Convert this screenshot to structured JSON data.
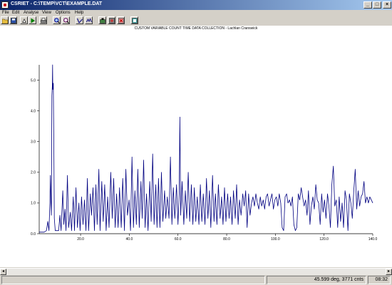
{
  "window": {
    "title": "CSRIET - C:\\TEMP\\VCT\\EXAMPLE.DAT"
  },
  "menu": [
    "File",
    "Edit",
    "Analyse",
    "View",
    "Options",
    "Help"
  ],
  "toolbar": {
    "icons": [
      "open-icon",
      "save-icon",
      "run-icon",
      "play-icon",
      "print-icon",
      "zoom-in-icon",
      "zoom-out-icon",
      "cursor-icon",
      "scale-icon",
      "export-icon",
      "color-icon",
      "delete-icon",
      "settings-icon"
    ]
  },
  "status": {
    "position": "45.599 deg, 3771 cnts",
    "time": "08:32"
  },
  "chart_data": {
    "type": "line",
    "title": "CUSTOM VARIABLE COUNT TIME DATA COLLECTION - Lachlan Cranswick",
    "xlabel": "",
    "ylabel": "",
    "xlim": [
      3,
      140
    ],
    "ylim": [
      0,
      5.5
    ],
    "x_ticks": [
      "20.0",
      "40.0",
      "60.0",
      "80.0",
      "100.0",
      "120.0",
      "140.0"
    ],
    "y_ticks": [
      "0.0",
      "1.0",
      "2.0",
      "3.0",
      "4.0",
      "5.0"
    ],
    "series": [
      {
        "points": [
          [
            3,
            0.05
          ],
          [
            5,
            0.05
          ],
          [
            6,
            0.1
          ],
          [
            6.5,
            0.4
          ],
          [
            7,
            0.1
          ],
          [
            7.4,
            1.0
          ],
          [
            7.6,
            1.9
          ],
          [
            7.8,
            1.0
          ],
          [
            8,
            0.6
          ],
          [
            8.2,
            4.5
          ],
          [
            8.4,
            4.8
          ],
          [
            8.5,
            5.5
          ],
          [
            8.6,
            4.7
          ],
          [
            8.8,
            4.9
          ],
          [
            9,
            3.0
          ],
          [
            9.2,
            0.5
          ],
          [
            9.6,
            0.1
          ],
          [
            11,
            0.1
          ],
          [
            11.5,
            0.6
          ],
          [
            12,
            0.1
          ],
          [
            12.7,
            1.4
          ],
          [
            13.1,
            0.3
          ],
          [
            13.6,
            0.8
          ],
          [
            14,
            0.1
          ],
          [
            14.6,
            1.9
          ],
          [
            15.1,
            0.2
          ],
          [
            15.8,
            0.7
          ],
          [
            16.3,
            0.1
          ],
          [
            17,
            1.2
          ],
          [
            17.5,
            0.1
          ],
          [
            18.1,
            1.5
          ],
          [
            18.7,
            0.2
          ],
          [
            19.3,
            1.0
          ],
          [
            19.8,
            0.1
          ],
          [
            20.4,
            1.2
          ],
          [
            21,
            0.3
          ],
          [
            21.6,
            1.1
          ],
          [
            22.2,
            0.1
          ],
          [
            22.8,
            1.8
          ],
          [
            23.3,
            0.1
          ],
          [
            24,
            1.3
          ],
          [
            24.5,
            0.6
          ],
          [
            25.1,
            1.5
          ],
          [
            25.7,
            0.1
          ],
          [
            26.3,
            1.6
          ],
          [
            26.8,
            0.3
          ],
          [
            27.5,
            2.1
          ],
          [
            28,
            0.1
          ],
          [
            28.7,
            1.7
          ],
          [
            29.3,
            0.4
          ],
          [
            29.9,
            1.6
          ],
          [
            30.5,
            0.1
          ],
          [
            31.1,
            1.2
          ],
          [
            31.7,
            0.2
          ],
          [
            32.4,
            2.0
          ],
          [
            33,
            0.5
          ],
          [
            33.6,
            1.8
          ],
          [
            34.2,
            0.2
          ],
          [
            34.8,
            1.3
          ],
          [
            35.4,
            0.2
          ],
          [
            36,
            1.5
          ],
          [
            36.7,
            0.2
          ],
          [
            37.3,
            1.8
          ],
          [
            38,
            0.1
          ],
          [
            38.6,
            2.1
          ],
          [
            39.2,
            0.6
          ],
          [
            39.9,
            1.1
          ],
          [
            40.5,
            0.1
          ],
          [
            41.1,
            2.5
          ],
          [
            41.7,
            0.2
          ],
          [
            42.3,
            1.4
          ],
          [
            42.9,
            0.3
          ],
          [
            43.5,
            2.1
          ],
          [
            44.1,
            0.2
          ],
          [
            44.8,
            1.7
          ],
          [
            45.3,
            0.5
          ],
          [
            45.9,
            2.4
          ],
          [
            46.5,
            0.2
          ],
          [
            47.1,
            1.3
          ],
          [
            47.7,
            0.1
          ],
          [
            48.4,
            1.7
          ],
          [
            49,
            0.4
          ],
          [
            49.6,
            2.6
          ],
          [
            50.2,
            0.3
          ],
          [
            50.9,
            1.6
          ],
          [
            51.4,
            0.2
          ],
          [
            52,
            1.8
          ],
          [
            52.6,
            0.2
          ],
          [
            53.2,
            2.0
          ],
          [
            53.8,
            0.4
          ],
          [
            54.5,
            1.4
          ],
          [
            55,
            0.5
          ],
          [
            55.6,
            1.2
          ],
          [
            56.3,
            0.5
          ],
          [
            56.9,
            2.5
          ],
          [
            57.5,
            0.3
          ],
          [
            58.1,
            1.5
          ],
          [
            58.7,
            0.5
          ],
          [
            59.4,
            1.6
          ],
          [
            60,
            0.3
          ],
          [
            60.5,
            1.3
          ],
          [
            60.8,
            3.8
          ],
          [
            61.1,
            0.6
          ],
          [
            61.7,
            1.7
          ],
          [
            62.4,
            0.3
          ],
          [
            63,
            1.4
          ],
          [
            63.6,
            0.5
          ],
          [
            64.2,
            2.0
          ],
          [
            64.8,
            0.4
          ],
          [
            65.5,
            1.6
          ],
          [
            66.1,
            0.3
          ],
          [
            66.7,
            1.5
          ],
          [
            67.3,
            0.4
          ],
          [
            67.9,
            1.2
          ],
          [
            68.6,
            0.3
          ],
          [
            69.2,
            1.6
          ],
          [
            69.8,
            0.4
          ],
          [
            70.4,
            1.3
          ],
          [
            71.1,
            0.3
          ],
          [
            71.7,
            1.8
          ],
          [
            72.3,
            0.5
          ],
          [
            72.9,
            1.4
          ],
          [
            73.5,
            0.2
          ],
          [
            74.2,
            1.9
          ],
          [
            74.8,
            0.4
          ],
          [
            75.4,
            1.3
          ],
          [
            76,
            0.3
          ],
          [
            76.6,
            1.6
          ],
          [
            77.3,
            0.5
          ],
          [
            77.9,
            1.2
          ],
          [
            78.5,
            0.3
          ],
          [
            79.1,
            1.5
          ],
          [
            79.7,
            0.4
          ],
          [
            80.4,
            1.3
          ],
          [
            81,
            0.5
          ],
          [
            81.6,
            1.2
          ],
          [
            82.2,
            0.3
          ],
          [
            82.8,
            1.4
          ],
          [
            83.5,
            0.5
          ],
          [
            84.1,
            1.6
          ],
          [
            84.7,
            0.3
          ],
          [
            85.3,
            1.1
          ],
          [
            85.9,
            0.6
          ],
          [
            86.6,
            1.3
          ],
          [
            87.2,
            0.9
          ],
          [
            87.8,
            1.4
          ],
          [
            88.4,
            0.2
          ],
          [
            89,
            1.3
          ],
          [
            89.6,
            0.6
          ],
          [
            90.2,
            1.0
          ],
          [
            90.8,
            1.2
          ],
          [
            91.4,
            0.9
          ],
          [
            92,
            1.3
          ],
          [
            92.6,
            1.0
          ],
          [
            93.2,
            0.8
          ],
          [
            93.8,
            1.2
          ],
          [
            94.4,
            0.9
          ],
          [
            95,
            1.1
          ],
          [
            95.6,
            0.8
          ],
          [
            96.2,
            1.2
          ],
          [
            96.8,
            1.3
          ],
          [
            97.4,
            0.9
          ],
          [
            98,
            1.1
          ],
          [
            98.6,
            1.3
          ],
          [
            99.2,
            0.8
          ],
          [
            99.8,
            1.1
          ],
          [
            100.4,
            1.2
          ],
          [
            101,
            0.9
          ],
          [
            101.6,
            1.3
          ],
          [
            102.2,
            1.0
          ],
          [
            102.8,
            0.2
          ],
          [
            103.4,
            0.1
          ],
          [
            104,
            1.2
          ],
          [
            104.6,
            1.3
          ],
          [
            105.2,
            1.0
          ],
          [
            105.8,
            1.1
          ],
          [
            106.4,
            0.9
          ],
          [
            107,
            1.2
          ],
          [
            107.6,
            0.3
          ],
          [
            108.2,
            0.1
          ],
          [
            108.8,
            0.2
          ],
          [
            109.4,
            1.3
          ],
          [
            110,
            1.1
          ],
          [
            110.6,
            1.5
          ],
          [
            111.2,
            1.2
          ],
          [
            111.8,
            0.9
          ],
          [
            112.4,
            1.1
          ],
          [
            113,
            0.6
          ],
          [
            113.6,
            1.4
          ],
          [
            114.2,
            0.3
          ],
          [
            114.8,
            0.9
          ],
          [
            115.4,
            1.2
          ],
          [
            116,
            0.8
          ],
          [
            116.6,
            1.6
          ],
          [
            117.2,
            1.1
          ],
          [
            117.8,
            1.0
          ],
          [
            118.4,
            0.3
          ],
          [
            119,
            1.3
          ],
          [
            119.6,
            0.7
          ],
          [
            120.2,
            1.1
          ],
          [
            120.8,
            0.5
          ],
          [
            121.4,
            1.3
          ],
          [
            122,
            0.9
          ],
          [
            122.6,
            0.2
          ],
          [
            123.2,
            1.6
          ],
          [
            123.8,
            2.2
          ],
          [
            124.4,
            0.9
          ],
          [
            125,
            1.1
          ],
          [
            125.6,
            0.2
          ],
          [
            126.2,
            1.2
          ],
          [
            126.8,
            0.4
          ],
          [
            127.4,
            1.0
          ],
          [
            128,
            0.2
          ],
          [
            128.6,
            1.4
          ],
          [
            129.2,
            1.1
          ],
          [
            129.8,
            0.1
          ],
          [
            130.4,
            1.3
          ],
          [
            131,
            1.0
          ],
          [
            131.6,
            0.5
          ],
          [
            132.2,
            1.4
          ],
          [
            132.8,
            2.1
          ],
          [
            133.4,
            0.8
          ],
          [
            134,
            1.4
          ],
          [
            134.6,
            0.9
          ],
          [
            135.2,
            1.2
          ],
          [
            135.8,
            1.3
          ],
          [
            136.4,
            1.7
          ],
          [
            137,
            1.0
          ],
          [
            137.6,
            1.2
          ],
          [
            138.2,
            1.0
          ],
          [
            138.8,
            1.2
          ],
          [
            139.4,
            1.1
          ],
          [
            140,
            1.0
          ]
        ]
      }
    ]
  }
}
